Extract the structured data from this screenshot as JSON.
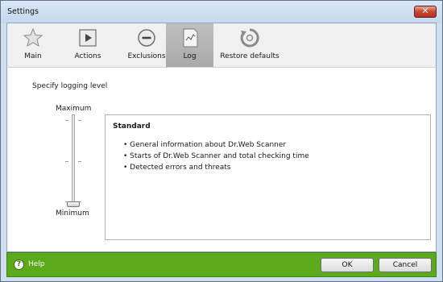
{
  "window": {
    "title": "Settings"
  },
  "toolbar": {
    "items": [
      {
        "label": "Main",
        "icon": "star-icon"
      },
      {
        "label": "Actions",
        "icon": "play-icon"
      },
      {
        "label": "Exclusions",
        "icon": "minus-circle-icon"
      },
      {
        "label": "Log",
        "icon": "log-document-icon",
        "active": true
      },
      {
        "label": "Restore defaults",
        "icon": "restore-icon"
      }
    ]
  },
  "log": {
    "specify_label": "Specify logging level",
    "slider": {
      "max_label": "Maximum",
      "min_label": "Minimum",
      "level": 0
    },
    "info": {
      "title": "Standard",
      "items": [
        "General information about Dr.Web Scanner",
        "Starts of Dr.Web Scanner and total checking time",
        "Detected errors and threats"
      ]
    }
  },
  "footer": {
    "help_label": "Help",
    "ok_label": "OK",
    "cancel_label": "Cancel"
  },
  "colors": {
    "footer_green": "#5aaa1c",
    "active_tab": "#b0b0b0"
  }
}
